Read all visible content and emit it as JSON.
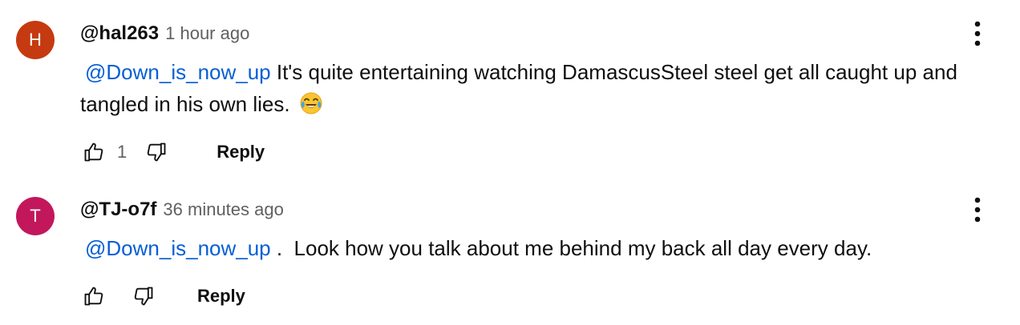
{
  "comments": [
    {
      "avatar": {
        "letter": "H",
        "color": "#c53a10"
      },
      "author": "@hal263",
      "time": "1 hour ago",
      "mention": "@Down_is_now_up",
      "text": " It's quite entertaining watching DamascusSteel steel get all caught up and tangled in his own lies. ",
      "emoji": "face-with-tears-of-joy",
      "likes": "1",
      "reply_label": "Reply",
      "icons": {
        "like": "thumb-up-icon",
        "dislike": "thumb-down-icon",
        "more": "more-vertical-icon"
      }
    },
    {
      "avatar": {
        "letter": "T",
        "color": "#c2185b"
      },
      "author": "@TJ-o7f",
      "time": "36 minutes ago",
      "mention": "@Down_is_now_up",
      "text": " .  Look how you talk about me behind my back all day every day.",
      "likes": "",
      "reply_label": "Reply",
      "icons": {
        "like": "thumb-up-icon",
        "dislike": "thumb-down-icon",
        "more": "more-vertical-icon"
      }
    }
  ],
  "colors": {
    "mention": "#065fd4",
    "secondary_text": "#606060",
    "primary_text": "#0f0f0f"
  }
}
